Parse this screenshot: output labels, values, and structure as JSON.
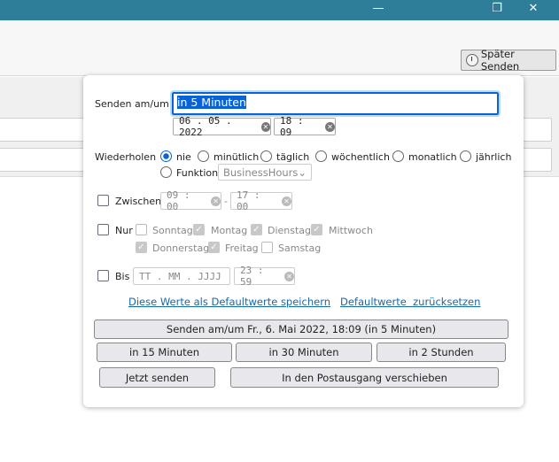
{
  "window": {
    "minimize": "—",
    "restore": "❐",
    "close": "✕"
  },
  "toolbar": {
    "later_send": "Später Senden"
  },
  "popup": {
    "send_label": "Senden am/um",
    "send_value": "in 5 Minuten",
    "date": "06 . 05 . 2022",
    "time": "18 : 09",
    "repeat_label": "Wiederholen",
    "repeat_options": [
      "nie",
      "minütlich",
      "täglich",
      "wöchentlich",
      "monatlich",
      "jährlich"
    ],
    "function_label": "Funktion",
    "function_value": "BusinessHours",
    "between_label": "Zwischen",
    "between_from": "09 : 00",
    "between_to": "17 : 00",
    "dash": "-",
    "only_label": "Nur",
    "days": [
      {
        "label": "Sonntag",
        "checked": false
      },
      {
        "label": "Montag",
        "checked": true
      },
      {
        "label": "Dienstag",
        "checked": true
      },
      {
        "label": "Mittwoch",
        "checked": true
      },
      {
        "label": "Donnerstag",
        "checked": true
      },
      {
        "label": "Freitag",
        "checked": true
      },
      {
        "label": "Samstag",
        "checked": false
      }
    ],
    "until_label": "Bis",
    "until_date_placeholder": "TT . MM . JJJJ",
    "until_time": "23 : 59",
    "save_defaults": "Diese Werte als Defaultwerte speichern",
    "reset_defaults": "Defaultwerte  zurücksetzen",
    "send_at_button": "Senden am/um Fr., 6. Mai 2022, 18:09 (in 5 Minuten)",
    "in15": "in 15 Minuten",
    "in30": "in 30 Minuten",
    "in2h": "in 2 Stunden",
    "send_now": "Jetzt senden",
    "move_outbox": "In den Postausgang verschieben"
  }
}
